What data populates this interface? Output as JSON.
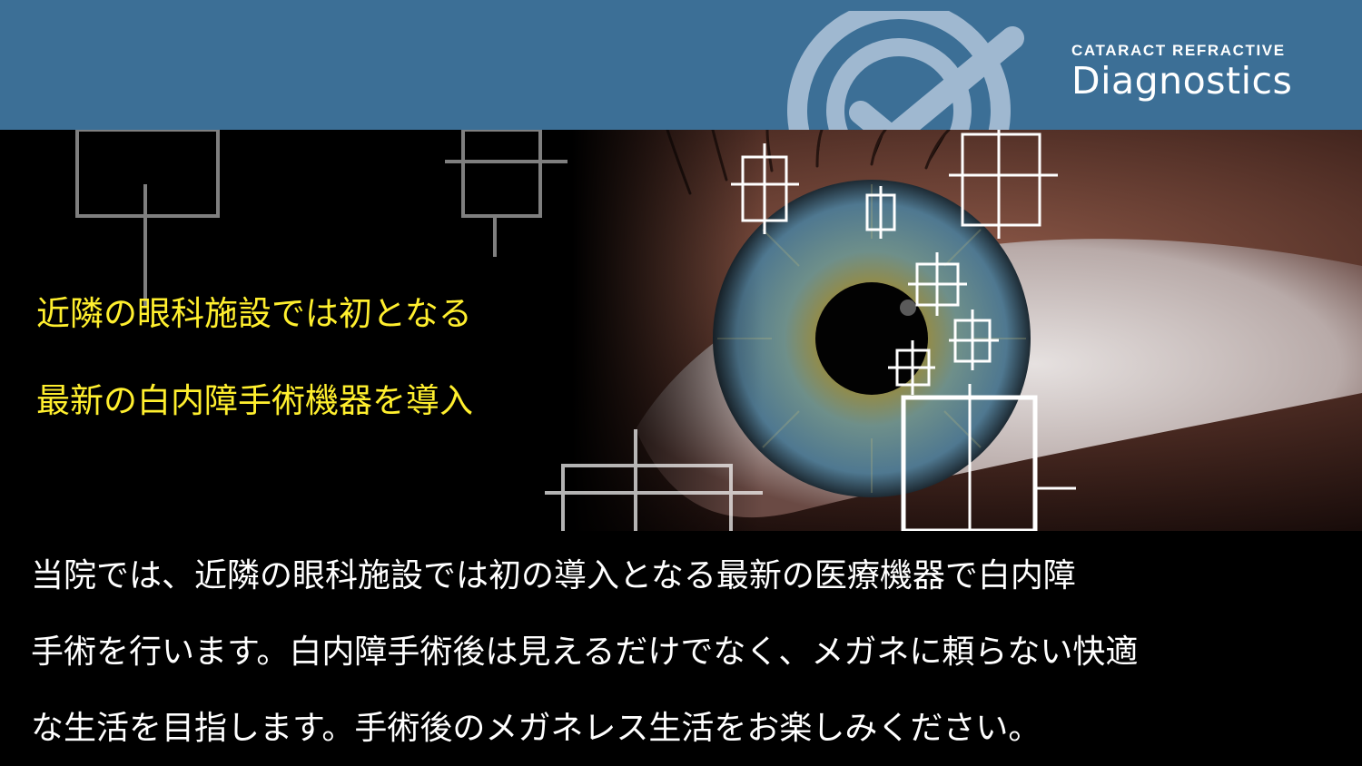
{
  "brand": {
    "top": "CATARACT REFRACTIVE",
    "bottom": "Diagnostics"
  },
  "headline": [
    "近隣の眼科施設では初となる",
    "最新の白内障手術機器を導入"
  ],
  "body": [
    "当院では、近隣の眼科施設では初の導入となる最新の医療機器で白内障",
    "手術を行います。白内障手術後は見えるだけでなく、メガネに頼らない快適",
    "な生活を目指します。手術後のメガネレス生活をお楽しみください。"
  ],
  "colors": {
    "header": "#3c6f96",
    "headline": "#ffef2e",
    "body_text": "#ffffff",
    "logo_mark": "#9fb8d0"
  }
}
